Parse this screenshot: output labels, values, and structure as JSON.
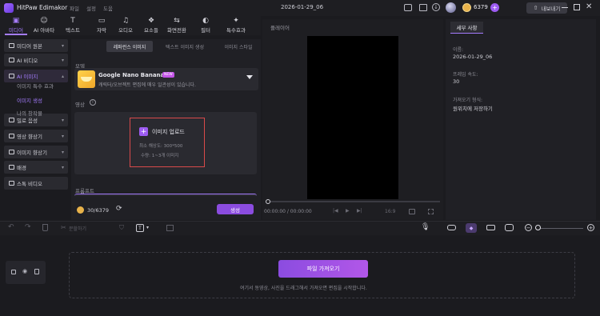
{
  "app": {
    "name": "HitPaw Edimakor",
    "menu": [
      "파일",
      "설정",
      "도움"
    ],
    "doc_title": "2026-01-29_06",
    "credits": "6379",
    "export_label": "내보내기"
  },
  "toptabs": [
    {
      "label": "미디어",
      "icon": "media-icon",
      "active": true
    },
    {
      "label": "AI 아바타",
      "icon": "avatar-icon"
    },
    {
      "label": "텍스트",
      "icon": "text-icon"
    },
    {
      "label": "자막",
      "icon": "subtitle-icon"
    },
    {
      "label": "오디오",
      "icon": "audio-icon"
    },
    {
      "label": "요소들",
      "icon": "elements-icon"
    },
    {
      "label": "화면전환",
      "icon": "transition-icon"
    },
    {
      "label": "필터",
      "icon": "filter-icon"
    },
    {
      "label": "특수효과",
      "icon": "effects-icon"
    }
  ],
  "sidebar": {
    "items": [
      {
        "label": "미디어 원본",
        "expand": "chevron-down"
      },
      {
        "label": "AI 비디오",
        "expand": "chevron-down"
      },
      {
        "label": "AI 이미지",
        "expand": "chevron-up",
        "active": true
      },
      {
        "label": "밀로 음성",
        "expand": "chevron-down"
      },
      {
        "label": "영상 향상기",
        "expand": "chevron-down"
      },
      {
        "label": "이미지 향상기",
        "expand": "chevron-down"
      },
      {
        "label": "배경",
        "expand": "chevron-down"
      },
      {
        "label": "스톡 비디오",
        "expand": ""
      }
    ],
    "subitems": [
      {
        "label": "이미지 특수 효과"
      },
      {
        "label": "이미지 생성",
        "active": true
      },
      {
        "label": "나의 창작물"
      }
    ]
  },
  "panel": {
    "tabs": [
      "레퍼런스 이미지",
      "텍스트 이미지 생성",
      "이미지 스타일"
    ],
    "model_label": "모델",
    "model": {
      "name": "Google Nano Banana",
      "badge": "NEW",
      "desc": "캐릭터/오브젝트 편집에 매우 일관성이 있습니다."
    },
    "reference_label": "영상",
    "upload": {
      "button": "이미지 업로드",
      "min_res": "최소 해상도: 300*500",
      "count": "수량: 1~3개 이미지"
    },
    "prompt_label": "프롬프트",
    "cost": "30/6379",
    "generate_label": "생성"
  },
  "player": {
    "title": "플레이어",
    "time": "00:00:00 / 00:00:00",
    "aspect": "16:9"
  },
  "details": {
    "tab": "세부 사항",
    "fields": [
      {
        "label": "이름:",
        "value": "2026-01-29_06"
      },
      {
        "label": "프레임 속도:",
        "value": "30"
      },
      {
        "label": "가져오기 형식:",
        "value": "원위치에 저장하기"
      }
    ]
  },
  "toolbar": {
    "split_label": "분할하기"
  },
  "timeline": {
    "import_label": "파일 가져오기",
    "hint": "여기서 동영상, 사진을 드래그해서 가져오면 편집을 시작합니다."
  },
  "colors": {
    "accent": "#a57cff",
    "upload_highlight": "#d94a4a",
    "generate": "#8b4ce0"
  }
}
